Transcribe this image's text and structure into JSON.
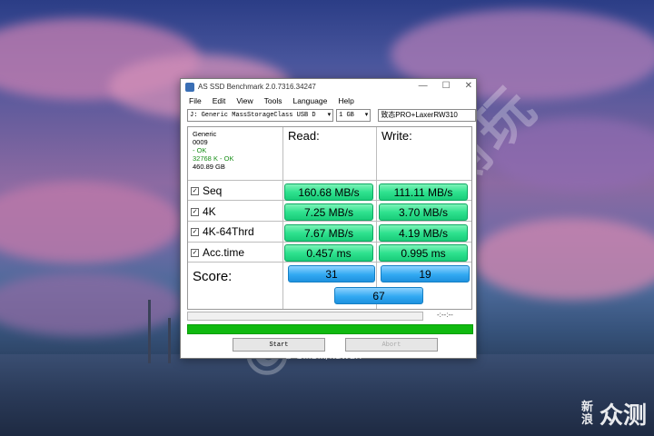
{
  "window": {
    "title": "AS SSD Benchmark 2.0.7316.34247",
    "minimize": "—",
    "maximize": "☐",
    "close": "✕"
  },
  "menu": [
    "File",
    "Edit",
    "View",
    "Tools",
    "Language",
    "Help"
  ],
  "toolbar": {
    "drive": "J: Generic MassStorageClass USB D",
    "size": "1 GB",
    "device_name": "致态PRO+LaxerRW310"
  },
  "info": {
    "model": "Generic",
    "firmware": "0009",
    "status1": "- OK",
    "status2": "32768 K - OK",
    "capacity": "460.89 GB"
  },
  "columns": {
    "read": "Read:",
    "write": "Write:"
  },
  "rows": [
    {
      "label": "Seq",
      "read": "160.68 MB/s",
      "write": "111.11 MB/s",
      "checked": true
    },
    {
      "label": "4K",
      "read": "7.25 MB/s",
      "write": "3.70 MB/s",
      "checked": true
    },
    {
      "label": "4K-64Thrd",
      "read": "7.67 MB/s",
      "write": "4.19 MB/s",
      "checked": true
    },
    {
      "label": "Acc.time",
      "read": "0.457 ms",
      "write": "0.995 ms",
      "checked": true
    }
  ],
  "score": {
    "label": "Score:",
    "read": "31",
    "write": "19",
    "total": "67"
  },
  "progress": {
    "time": "-:--:--",
    "bar1": 0,
    "bar2": 1.0
  },
  "buttons": {
    "start": "Start",
    "abort": "Abort"
  },
  "overlay": {
    "watermark": "© 笔吧评测玩",
    "copyright": "© bilibili/kuwan",
    "brand_small": "新浪",
    "brand_big": "众测"
  },
  "colors": {
    "result_green": "#2fe28f",
    "score_blue": "#32a9f2",
    "progress_green": "#10b910"
  }
}
